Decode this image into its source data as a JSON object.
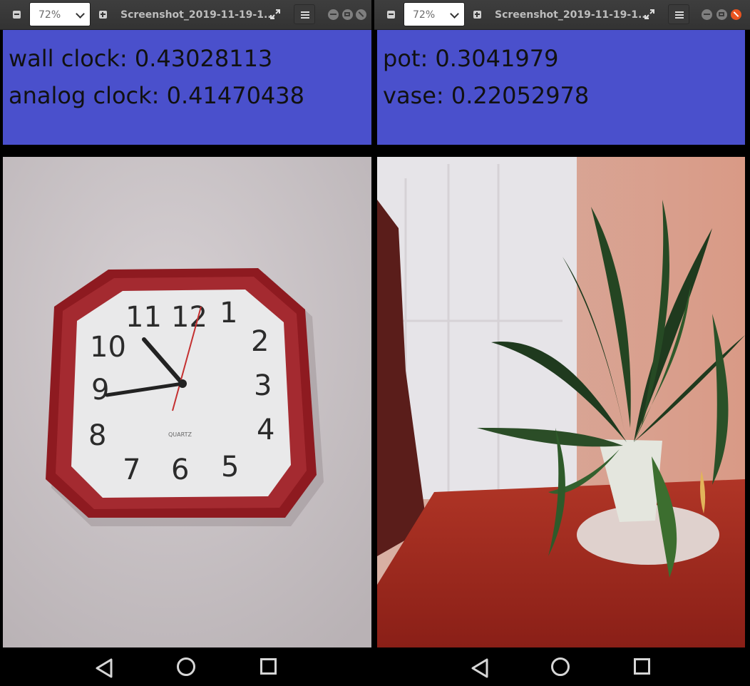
{
  "windows": [
    {
      "zoom": "72%",
      "title": "Screenshot_2019-11-19-1...",
      "results": [
        {
          "label": "wall clock: 0.43028113"
        },
        {
          "label": "analog clock: 0.41470438"
        }
      ],
      "clock_numerals": [
        "12",
        "1",
        "2",
        "3",
        "4",
        "5",
        "6",
        "7",
        "8",
        "9",
        "10",
        "11"
      ],
      "clock_brand": "QUARTZ"
    },
    {
      "zoom": "72%",
      "title": "Screenshot_2019-11-19-1...",
      "results": [
        {
          "label": "pot: 0.3041979"
        },
        {
          "label": "vase: 0.22052978"
        }
      ]
    }
  ],
  "colors": {
    "result_panel": "#4a50cc",
    "titlebar": "#3a3a3a",
    "close_button": "#e95420",
    "clock_frame": "#8e1a20",
    "table": "#a3261c"
  },
  "icons": {
    "zoom_out": "zoom-out-icon",
    "zoom_in": "zoom-in-icon",
    "fullscreen": "fullscreen-icon",
    "menu": "hamburger-menu-icon",
    "back": "back-triangle-icon",
    "home": "home-circle-icon",
    "recents": "recents-square-icon"
  }
}
